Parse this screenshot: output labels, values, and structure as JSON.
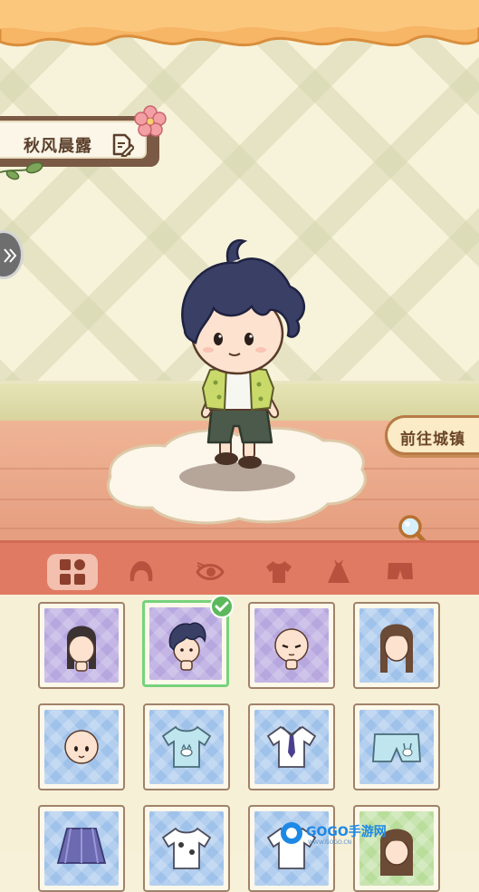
{
  "character": {
    "name": "秋风晨露"
  },
  "stage": {
    "goto_town_label": "前往城镇"
  },
  "tabs": [
    {
      "id": "all",
      "icon": "grid-icon",
      "active": true
    },
    {
      "id": "hair",
      "icon": "hair-icon",
      "active": false
    },
    {
      "id": "eyes",
      "icon": "eye-icon",
      "active": false
    },
    {
      "id": "tops",
      "icon": "shirt-icon",
      "active": false
    },
    {
      "id": "dresses",
      "icon": "dress-icon",
      "active": false
    },
    {
      "id": "bottoms",
      "icon": "shorts-icon",
      "active": false
    }
  ],
  "items": [
    {
      "type": "long-dark-hair",
      "bg": "purple",
      "selected": false
    },
    {
      "type": "spiky-navy-hair",
      "bg": "purple",
      "selected": true
    },
    {
      "type": "bald-face-stern",
      "bg": "purple",
      "selected": false
    },
    {
      "type": "long-brown-hair",
      "bg": "blue",
      "selected": false
    },
    {
      "type": "bald-face-smile",
      "bg": "blue",
      "selected": false
    },
    {
      "type": "blue-cat-tshirt",
      "bg": "blue",
      "selected": false
    },
    {
      "type": "white-shirt-tie",
      "bg": "blue",
      "selected": false
    },
    {
      "type": "bunny-shorts",
      "bg": "blue",
      "selected": false
    },
    {
      "type": "plaid-skirt",
      "bg": "blue",
      "selected": false
    },
    {
      "type": "cat-pattern-top",
      "bg": "blue",
      "selected": false
    },
    {
      "type": "white-top",
      "bg": "blue",
      "selected": false
    },
    {
      "type": "brown-hair-girl",
      "bg": "green",
      "selected": false
    }
  ],
  "watermark": {
    "brand": "GOGO手游网",
    "url": "WWW.GOGO.CN"
  },
  "colors": {
    "tab_bar": "#e07a62",
    "selected_border": "#77d27c",
    "floor": "#efb495"
  }
}
